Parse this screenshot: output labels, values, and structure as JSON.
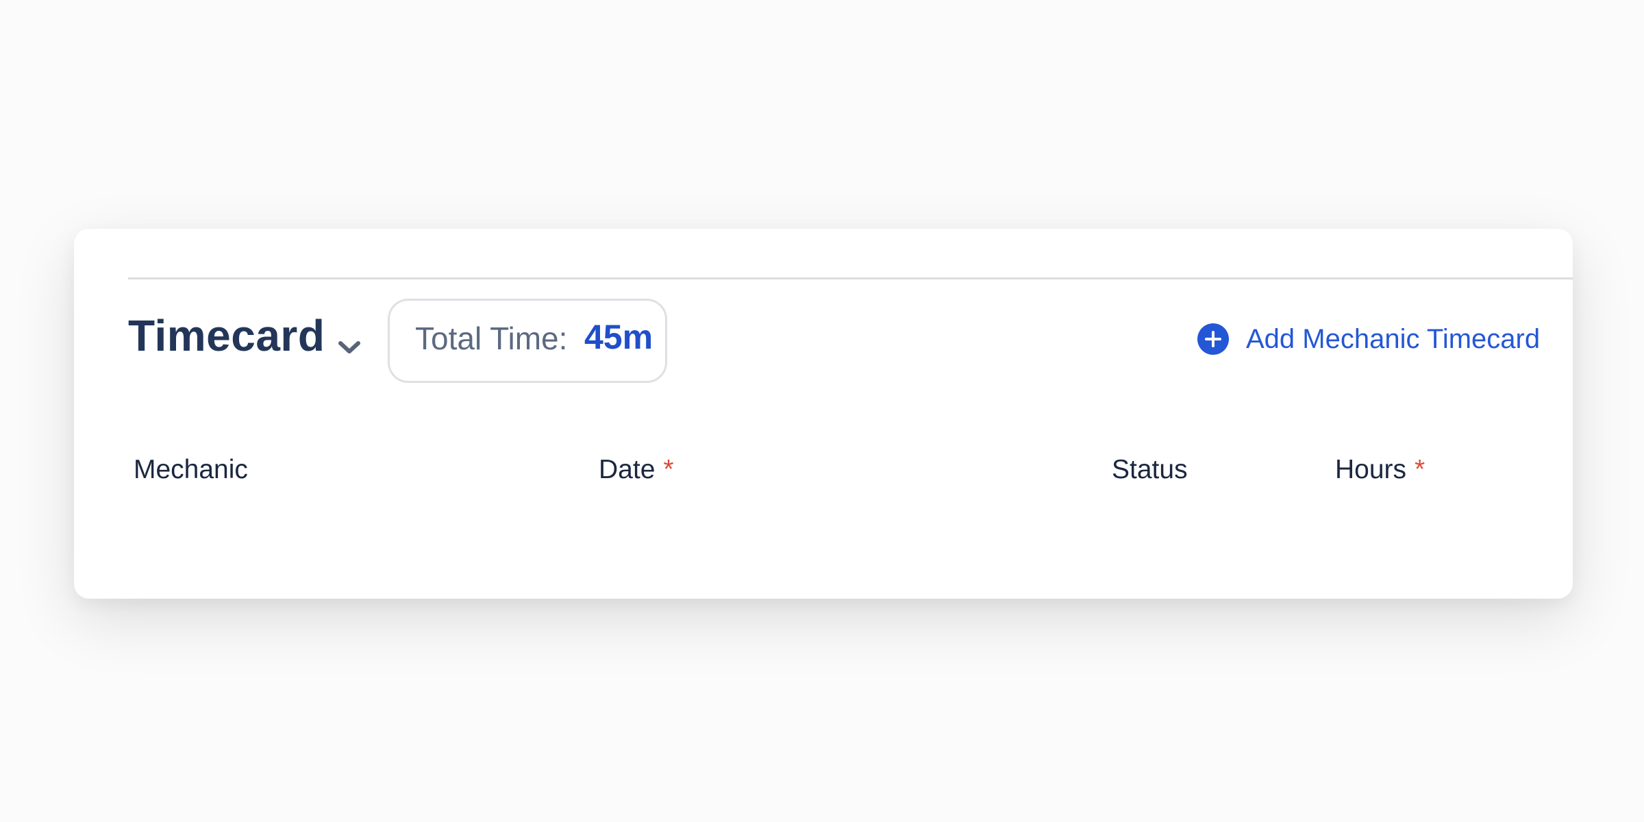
{
  "timecard": {
    "title": "Timecard",
    "total_time_label": "Total Time:",
    "total_time_value": "45m",
    "add_button_label": "Add Mechanic Timecard",
    "table": {
      "columns": [
        {
          "label": "Mechanic",
          "required": false
        },
        {
          "label": "Date",
          "required": true
        },
        {
          "label": "Status",
          "required": false
        },
        {
          "label": "Hours",
          "required": true
        }
      ],
      "required_marker": "*"
    }
  },
  "icons": {
    "title_toggle": "chevron-down-icon",
    "add_button": "plus-circle-icon"
  },
  "colors": {
    "accent": "#1f4fc9",
    "title": "#233659",
    "required": "#e04a3a"
  }
}
